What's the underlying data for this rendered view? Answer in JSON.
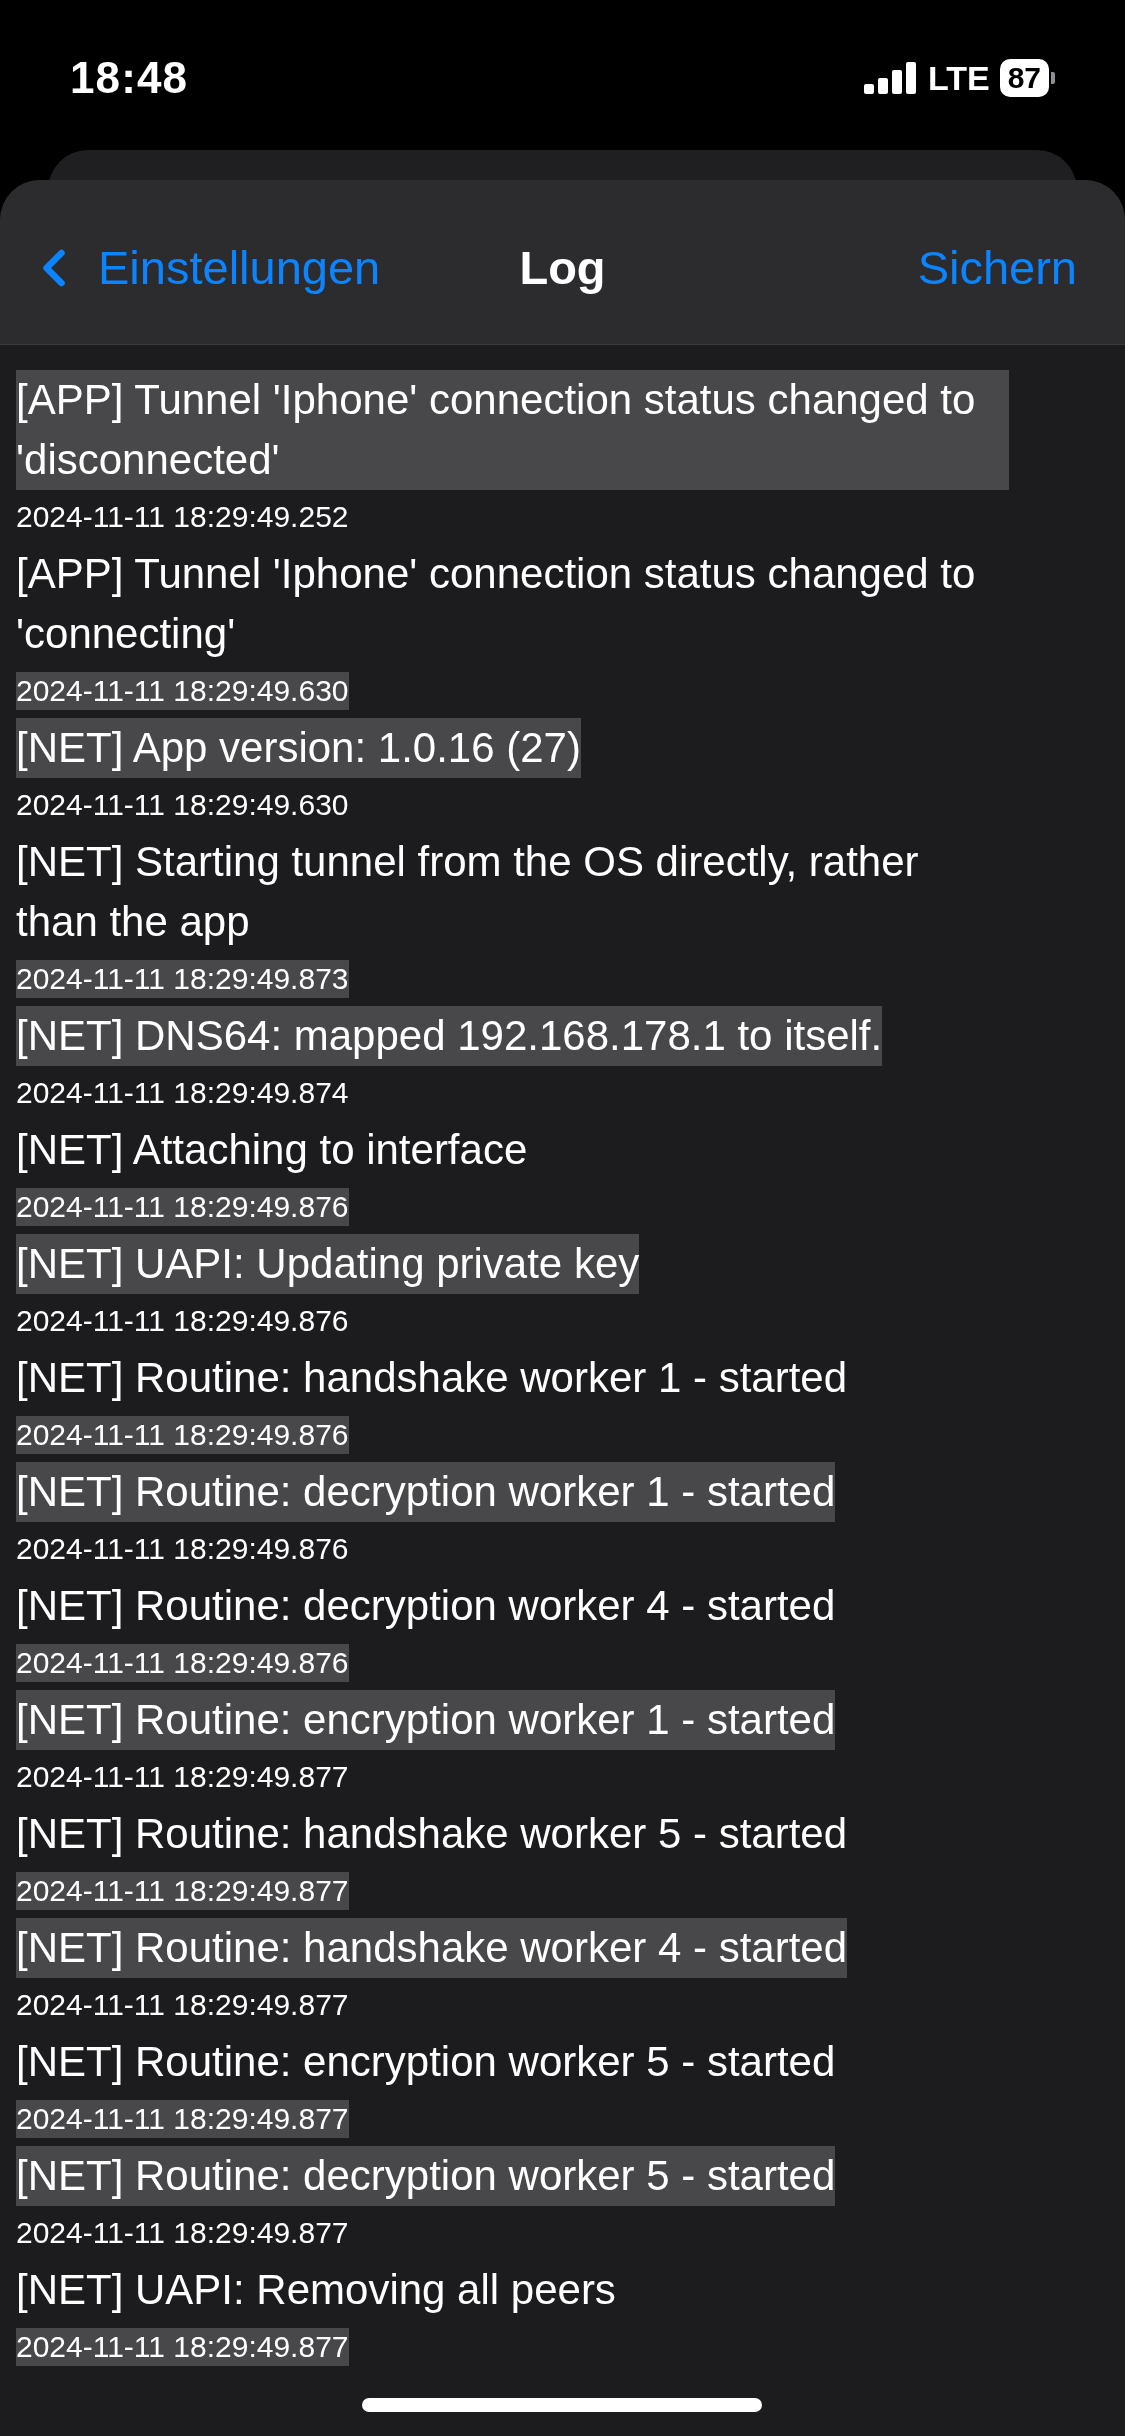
{
  "status_bar": {
    "time": "18:48",
    "network": "LTE",
    "battery": "87"
  },
  "nav": {
    "back": "Einstellungen",
    "title": "Log",
    "action": "Sichern"
  },
  "entries": [
    {
      "message": "[APP] Tunnel 'Iphone' connection status changed to 'disconnected'",
      "highlighted": true
    },
    {
      "timestamp": "2024-11-11 18:29:49.252",
      "message": "[APP] Tunnel 'Iphone' connection status changed to 'connecting'",
      "highlighted": false
    },
    {
      "timestamp": "2024-11-11 18:29:49.630",
      "message": "[NET] App version: 1.0.16 (27)",
      "highlighted": true
    },
    {
      "timestamp": "2024-11-11 18:29:49.630",
      "message": "[NET] Starting tunnel from the OS directly, rather than the app",
      "highlighted": false
    },
    {
      "timestamp": "2024-11-11 18:29:49.873",
      "message": "[NET] DNS64: mapped 192.168.178.1 to itself.",
      "highlighted": true
    },
    {
      "timestamp": "2024-11-11 18:29:49.874",
      "message": "[NET] Attaching to interface",
      "highlighted": false
    },
    {
      "timestamp": "2024-11-11 18:29:49.876",
      "message": "[NET] UAPI: Updating private key",
      "highlighted": true
    },
    {
      "timestamp": "2024-11-11 18:29:49.876",
      "message": "[NET] Routine: handshake worker 1 - started",
      "highlighted": false
    },
    {
      "timestamp": "2024-11-11 18:29:49.876",
      "message": "[NET] Routine: decryption worker 1 - started",
      "highlighted": true
    },
    {
      "timestamp": "2024-11-11 18:29:49.876",
      "message": "[NET] Routine: decryption worker 4 - started",
      "highlighted": false
    },
    {
      "timestamp": "2024-11-11 18:29:49.876",
      "message": "[NET] Routine: encryption worker 1 - started",
      "highlighted": true
    },
    {
      "timestamp": "2024-11-11 18:29:49.877",
      "message": "[NET] Routine: handshake worker 5 - started",
      "highlighted": false
    },
    {
      "timestamp": "2024-11-11 18:29:49.877",
      "message": "[NET] Routine: handshake worker 4 - started",
      "highlighted": true
    },
    {
      "timestamp": "2024-11-11 18:29:49.877",
      "message": "[NET] Routine: encryption worker 5 - started",
      "highlighted": false
    },
    {
      "timestamp": "2024-11-11 18:29:49.877",
      "message": "[NET] Routine: decryption worker 5 - started",
      "highlighted": true
    },
    {
      "timestamp": "2024-11-11 18:29:49.877",
      "message": "[NET] UAPI: Removing all peers",
      "highlighted": false
    },
    {
      "timestamp": "2024-11-11 18:29:49.877",
      "highlighted": true
    }
  ]
}
